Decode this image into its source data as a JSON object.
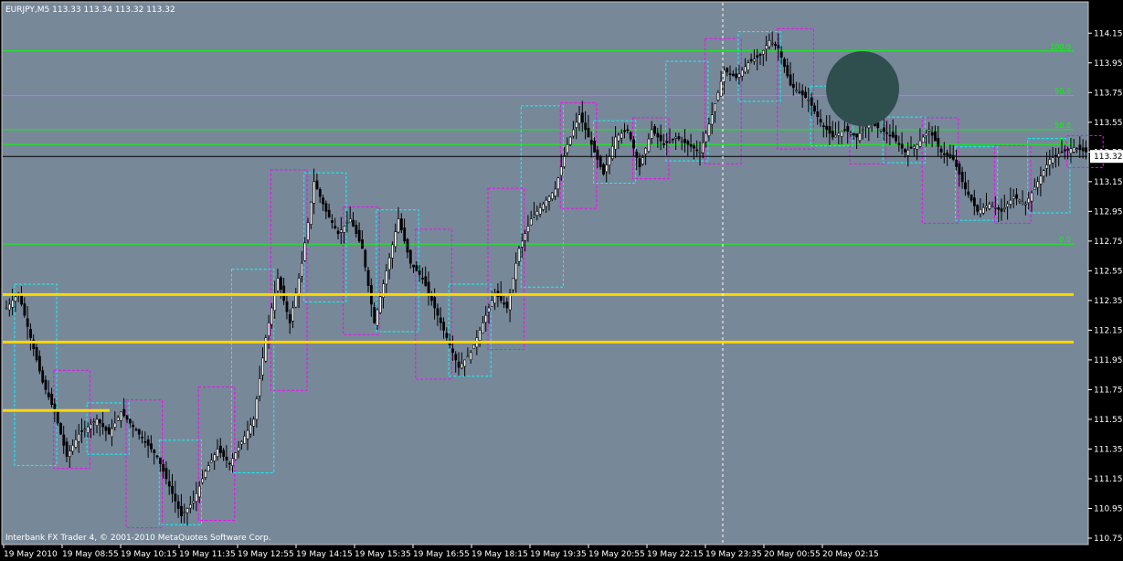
{
  "header": {
    "text": "EURJPY,M5  113.33 113.34 113.32 113.32"
  },
  "footer": {
    "copyright": "Interbank FX Trader 4, © 2001-2010 MetaQuotes Software Corp."
  },
  "colors": {
    "background": "#778899",
    "frame": "#000000",
    "candle": "#000000",
    "fib": "#00ff00",
    "support": "#ffd700",
    "box_cyan": "#00ffff",
    "box_magenta": "#ff00ff",
    "overlay_ellipse": "#2f4f4f",
    "bid_line": "#000000"
  },
  "chart_data": {
    "type": "candlestick",
    "symbol": "EURJPY",
    "timeframe": "M5",
    "ohlc_header": {
      "open": 113.33,
      "high": 113.34,
      "low": 113.32,
      "close": 113.32
    },
    "y_axis": {
      "min": 110.75,
      "max": 114.25,
      "ticks": [
        "114.15",
        "113.95",
        "113.75",
        "113.55",
        "113.35",
        "113.15",
        "112.95",
        "112.75",
        "112.55",
        "112.35",
        "112.15",
        "111.95",
        "111.75",
        "111.55",
        "111.35",
        "111.15",
        "110.95",
        "110.75"
      ]
    },
    "x_axis": {
      "labels": [
        "19 May 2010",
        "19 May 08:55",
        "19 May 10:15",
        "19 May 11:35",
        "19 May 12:55",
        "19 May 14:15",
        "19 May 15:35",
        "19 May 16:55",
        "19 May 18:15",
        "19 May 19:35",
        "19 May 20:55",
        "19 May 22:15",
        "19 May 23:35",
        "20 May 00:55",
        "20 May 02:15"
      ],
      "bars": 231
    },
    "current_price": {
      "value": 113.32,
      "label": "113.32"
    },
    "price_path": [
      [
        0,
        112.3
      ],
      [
        4,
        112.4
      ],
      [
        8,
        112.1
      ],
      [
        12,
        111.8
      ],
      [
        16,
        111.6
      ],
      [
        20,
        111.3
      ],
      [
        24,
        111.45
      ],
      [
        30,
        111.55
      ],
      [
        34,
        111.45
      ],
      [
        38,
        111.6
      ],
      [
        42,
        111.5
      ],
      [
        46,
        111.4
      ],
      [
        50,
        111.3
      ],
      [
        54,
        111.1
      ],
      [
        58,
        110.9
      ],
      [
        62,
        111.0
      ],
      [
        66,
        111.2
      ],
      [
        70,
        111.35
      ],
      [
        74,
        111.25
      ],
      [
        78,
        111.4
      ],
      [
        82,
        111.55
      ],
      [
        86,
        112.1
      ],
      [
        90,
        112.5
      ],
      [
        94,
        112.2
      ],
      [
        98,
        112.6
      ],
      [
        102,
        113.15
      ],
      [
        106,
        112.95
      ],
      [
        110,
        112.8
      ],
      [
        114,
        112.9
      ],
      [
        118,
        112.7
      ],
      [
        122,
        112.2
      ],
      [
        126,
        112.55
      ],
      [
        130,
        112.9
      ],
      [
        134,
        112.6
      ],
      [
        138,
        112.5
      ],
      [
        142,
        112.3
      ],
      [
        146,
        112.1
      ],
      [
        150,
        111.9
      ],
      [
        154,
        112.0
      ],
      [
        158,
        112.2
      ],
      [
        162,
        112.4
      ],
      [
        166,
        112.3
      ],
      [
        170,
        112.7
      ],
      [
        174,
        112.9
      ],
      [
        178,
        113.0
      ],
      [
        182,
        113.1
      ],
      [
        186,
        113.4
      ],
      [
        190,
        113.6
      ],
      [
        194,
        113.4
      ],
      [
        198,
        113.2
      ],
      [
        202,
        113.45
      ],
      [
        206,
        113.5
      ],
      [
        210,
        113.25
      ],
      [
        214,
        113.5
      ],
      [
        218,
        113.4
      ],
      [
        222,
        113.45
      ],
      [
        226,
        113.4
      ],
      [
        230,
        113.35
      ],
      [
        234,
        113.6
      ],
      [
        238,
        113.9
      ],
      [
        242,
        113.85
      ],
      [
        246,
        113.95
      ],
      [
        250,
        114.0
      ],
      [
        253,
        114.1
      ],
      [
        256,
        114.05
      ],
      [
        260,
        113.8
      ],
      [
        263,
        113.75
      ],
      [
        266,
        113.7
      ],
      [
        270,
        113.55
      ],
      [
        274,
        113.45
      ],
      [
        278,
        113.5
      ],
      [
        282,
        113.45
      ],
      [
        286,
        113.55
      ],
      [
        290,
        113.5
      ],
      [
        294,
        113.45
      ],
      [
        298,
        113.35
      ],
      [
        302,
        113.4
      ],
      [
        306,
        113.5
      ],
      [
        310,
        113.35
      ],
      [
        314,
        113.3
      ],
      [
        318,
        113.1
      ],
      [
        322,
        112.95
      ],
      [
        326,
        113.0
      ],
      [
        330,
        112.95
      ],
      [
        334,
        113.05
      ],
      [
        338,
        113.0
      ],
      [
        342,
        113.15
      ],
      [
        346,
        113.3
      ],
      [
        350,
        113.35
      ],
      [
        354,
        113.38
      ],
      [
        358,
        113.35
      ]
    ],
    "fib_levels": [
      {
        "label": "100.0",
        "price": 114.03
      },
      {
        "label": "50.0",
        "price": 113.73
      },
      {
        "label": "50.0",
        "price": 113.5
      },
      {
        "label": "0.0",
        "price": 113.4
      },
      {
        "label": "0.0",
        "price": 112.73
      }
    ],
    "support_lines": [
      112.39,
      112.07,
      111.61
    ]
  }
}
